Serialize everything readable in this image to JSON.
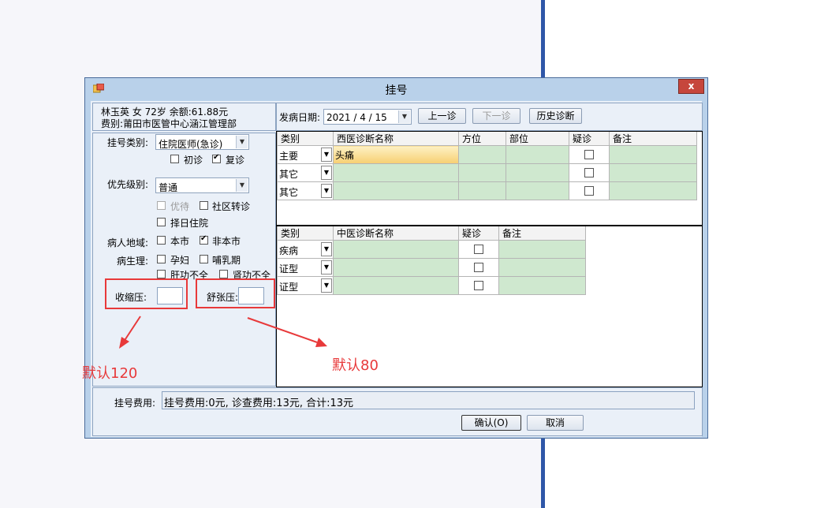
{
  "window": {
    "title": "挂号",
    "close_label": "x"
  },
  "patient": {
    "line1": "林玉英 女 72岁 余额:61.88元",
    "line2": "费别:莆田市医管中心涵江管理部"
  },
  "form": {
    "reg_type_label": "挂号类别:",
    "reg_type_value": "住院医师(急诊)",
    "first_visit_label": "初诊",
    "return_visit_label": "复诊",
    "priority_label": "优先级别:",
    "priority_value": "普通",
    "preferential_label": "优待",
    "community_referral_label": "社区转诊",
    "select_day_label": "择日住院",
    "region_label": "病人地域:",
    "local_label": "本市",
    "nonlocal_label": "非本市",
    "physio_label": "病生理:",
    "pregnant_label": "孕妇",
    "lactation_label": "哺乳期",
    "liver_label": "肝功不全",
    "kidney_label": "肾功不全",
    "systolic_label": "收缩压:",
    "diastolic_label": "舒张压:",
    "systolic_value": "",
    "diastolic_value": ""
  },
  "toolbar": {
    "onset_date_label": "发病日期:",
    "onset_date_value": "2021 / 4 / 15",
    "prev_visit_label": "上一诊",
    "next_visit_label": "下一诊",
    "history_label": "历史诊断"
  },
  "western_grid": {
    "headers": [
      "类别",
      "西医诊断名称",
      "方位",
      "部位",
      "疑诊",
      "备注"
    ],
    "rows": [
      {
        "category": "主要",
        "name": "头痛"
      },
      {
        "category": "其它",
        "name": ""
      },
      {
        "category": "其它",
        "name": ""
      }
    ]
  },
  "tcm_grid": {
    "headers": [
      "类别",
      "中医诊断名称",
      "疑诊",
      "备注"
    ],
    "rows": [
      {
        "category": "疾病",
        "name": ""
      },
      {
        "category": "证型",
        "name": ""
      },
      {
        "category": "证型",
        "name": ""
      }
    ]
  },
  "footer": {
    "fee_label": "挂号费用:",
    "fee_value": "挂号费用:0元, 诊查费用:13元, 合计:13元",
    "ok_label": "确认(O)",
    "cancel_label": "取消"
  },
  "annotations": {
    "systolic_default": "默认120",
    "diastolic_default": "默认80"
  },
  "colors": {
    "annotation_red": "#e8393a",
    "grid_green": "#cfe8cf",
    "dialog_frame": "#b9d1ea"
  }
}
